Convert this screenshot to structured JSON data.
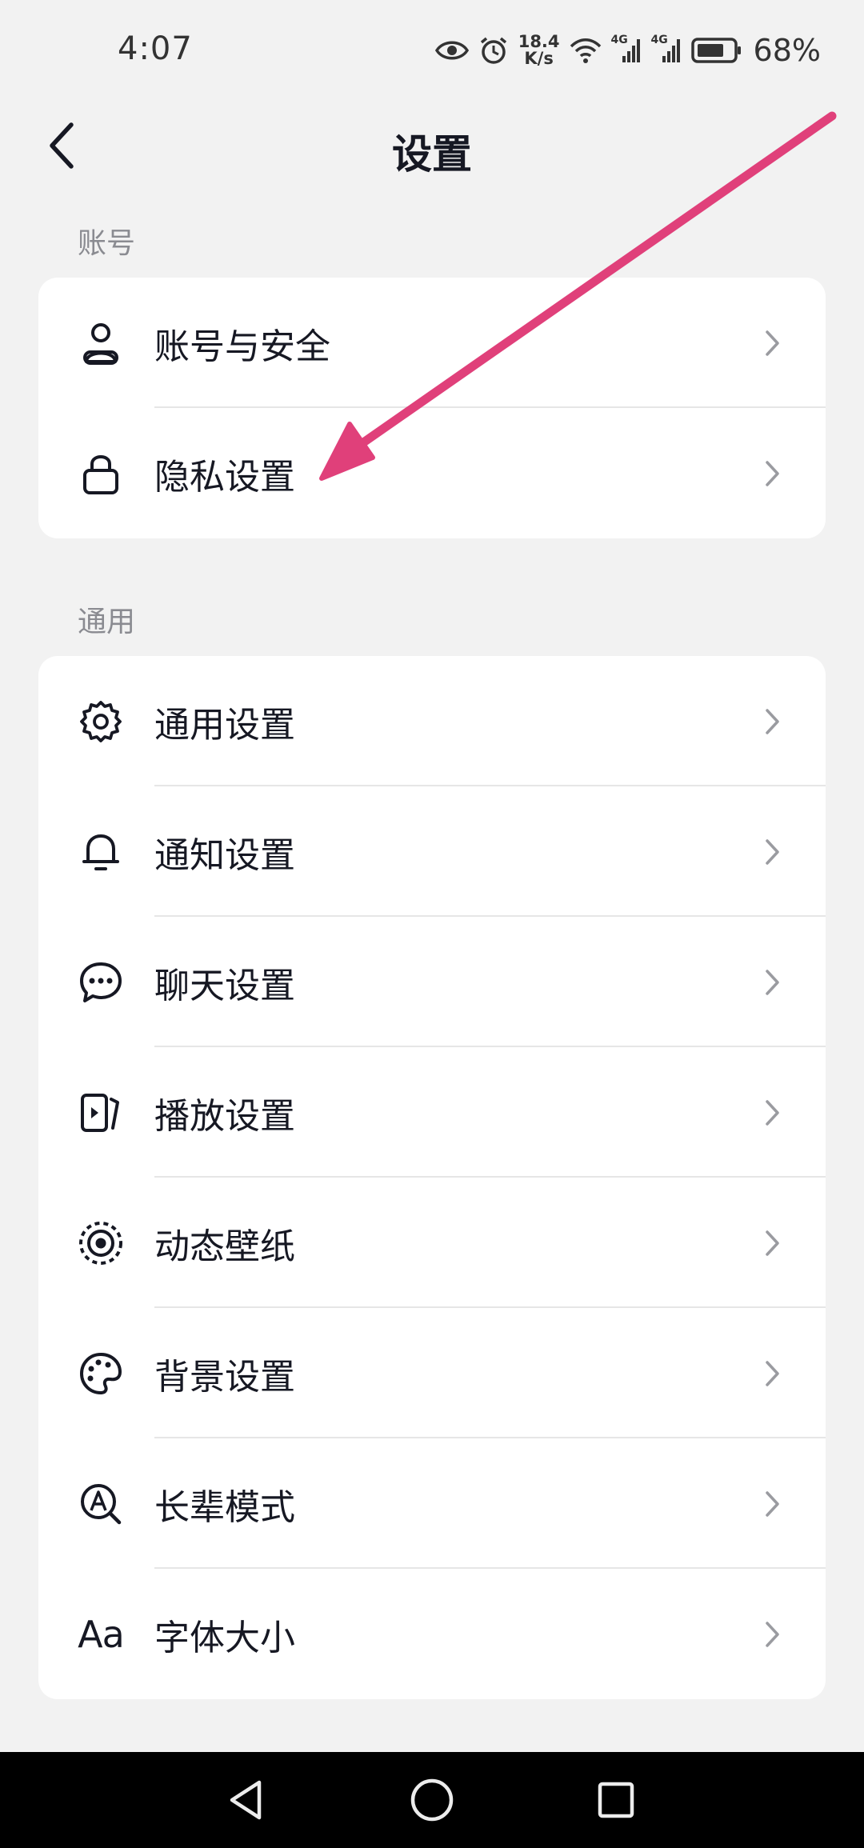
{
  "status_bar": {
    "time": "4:07",
    "speed_value": "18.4",
    "speed_unit": "K/s",
    "network_1": "4G",
    "network_2": "4G",
    "battery_percent": "68%",
    "icons": [
      "eye-icon",
      "alarm-icon",
      "wifi-icon",
      "signal-icon",
      "signal-icon",
      "battery-icon"
    ]
  },
  "header": {
    "title": "设置",
    "back_icon": "back-arrow-icon"
  },
  "sections": [
    {
      "title": "账号",
      "items": [
        {
          "label": "账号与安全",
          "icon": "user-icon"
        },
        {
          "label": "隐私设置",
          "icon": "lock-icon"
        }
      ]
    },
    {
      "title": "通用",
      "items": [
        {
          "label": "通用设置",
          "icon": "gear-icon"
        },
        {
          "label": "通知设置",
          "icon": "bell-icon"
        },
        {
          "label": "聊天设置",
          "icon": "chat-bubble-icon"
        },
        {
          "label": "播放设置",
          "icon": "play-card-icon"
        },
        {
          "label": "动态壁纸",
          "icon": "dynamic-wallpaper-icon"
        },
        {
          "label": "背景设置",
          "icon": "palette-icon"
        },
        {
          "label": "长辈模式",
          "icon": "elder-mode-icon"
        },
        {
          "label": "字体大小",
          "icon": "font-size-icon",
          "icon_text": "Aa"
        }
      ]
    }
  ],
  "colors": {
    "background": "#f2f2f2",
    "card": "#ffffff",
    "text": "#161823",
    "section_label": "#8a8b91",
    "annotation_arrow": "#e0407a",
    "system_nav": "#000000"
  }
}
